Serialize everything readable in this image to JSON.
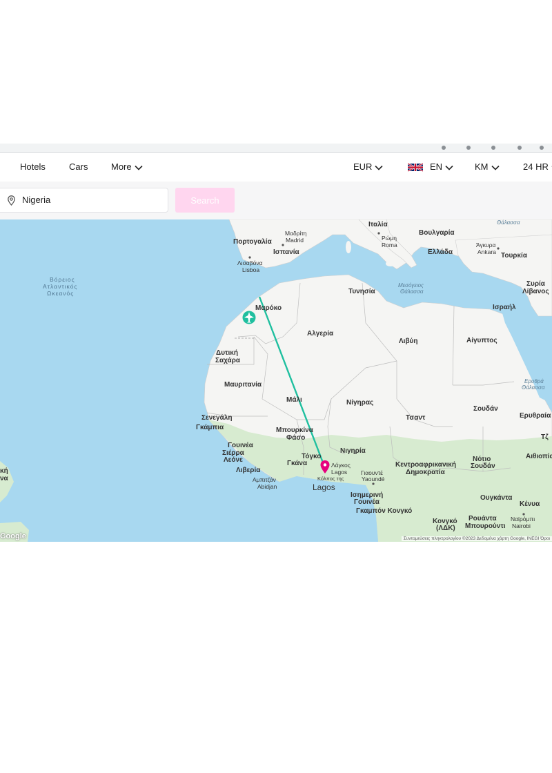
{
  "nav": {
    "hotels": "Hotels",
    "cars": "Cars",
    "more": "More",
    "currency": "EUR",
    "language": "EN",
    "distance_unit": "KM",
    "time_format": "24 HR"
  },
  "search": {
    "value": "Nigeria",
    "button": "Search",
    "button_color": "#ffd6ef"
  },
  "map": {
    "colors": {
      "water": "#a8d8f0",
      "land": "#f5f5f3",
      "green": "#cfe8c8",
      "route": "#1fbf9f",
      "destination_pin": "#e6007e",
      "origin_marker": "#1fbf9f"
    },
    "countries": {
      "portugal": "Πορτογαλία",
      "spain": "Ισπανία",
      "italy": "Ιταλία",
      "bulgaria": "Βουλγαρία",
      "greece": "Ελλάδα",
      "turkey": "Τουρκία",
      "syria": "Συρία",
      "lebanon": "Λίβανος",
      "israel": "Ισραήλ",
      "tunisia": "Τυνησία",
      "morocco": "Μαρόκο",
      "algeria": "Αλγερία",
      "libya": "Λιβύη",
      "egypt": "Αίγυπτος",
      "western_sahara_1": "Δυτική",
      "western_sahara_2": "Σαχάρα",
      "mauritania": "Μαυριτανία",
      "mali": "Μάλι",
      "niger": "Νίγηρας",
      "chad": "Τσαντ",
      "sudan": "Σουδάν",
      "eritrea": "Ερυθραία",
      "senegal": "Σενεγάλη",
      "gambia": "Γκάμπια",
      "burkina_1": "Μπουρκίνα",
      "burkina_2": "Φάσο",
      "guinea": "Γουινέα",
      "sierra_leone_1": "Σιέρρα",
      "sierra_leone_2": "Λεόνε",
      "liberia": "Λιβερία",
      "ghana": "Γκάνα",
      "togo": "Τόγκο",
      "nigeria": "Νιγηρία",
      "car_1": "Κεντροαφρικανική",
      "car_2": "Δημοκρατία",
      "south_sudan_1": "Νότιο",
      "south_sudan_2": "Σουδάν",
      "ethiopia": "Αιθιοπία",
      "djibouti": "Τζ",
      "eq_guinea_1": "Ισημερινή",
      "eq_guinea_2": "Γουινέα",
      "gabon_congo": "Γκαμπόν Κονγκό",
      "drc_1": "Κονγκό",
      "drc_2": "(ΛΔΚ)",
      "uganda": "Ουγκάντα",
      "kenya": "Κένυα",
      "rwanda": "Ρουάντα",
      "burundi": "Μπουρούντι",
      "left_edge_1": "κή",
      "left_edge_2": "να"
    },
    "cities": {
      "madrid_1": "Μαδρίτη",
      "madrid_2": "Madrid",
      "lisbon_1": "Λισαβόνα",
      "lisbon_2": "Lisboa",
      "rome_1": "Ρώμη",
      "rome_2": "Roma",
      "ankara_1": "Άγκυρα",
      "ankara_2": "Ankara",
      "abidjan_1": "Αμπιτζάν",
      "abidjan_2": "Abidjan",
      "lagos_1": "Λάγκος",
      "lagos_2": "Lagos",
      "lagos_big": "Lagos",
      "yaounde_1": "Γιαουντέ",
      "yaounde_2": "Yaoundé",
      "nairobi_1": "Ναϊρόμπι",
      "nairobi_2": "Nairobi",
      "gulf_1": "Κόλπος της"
    },
    "seas": {
      "atlantic_1": "Βόρειος",
      "atlantic_2": "Ατλαντικός",
      "atlantic_3": "Ωκεανός",
      "med_1": "Μεσόγειος",
      "med_2": "Θάλασσα",
      "black_sea": "Θάλασσα",
      "red_sea_1": "Ερυθρά",
      "red_sea_2": "Θάλασσα"
    },
    "google_logo": "Google",
    "attribution": "Συντομεύσεις πληκτρολογίου   ©2023 Δεδομένα χάρτη Google, INEGI   Όροι"
  }
}
